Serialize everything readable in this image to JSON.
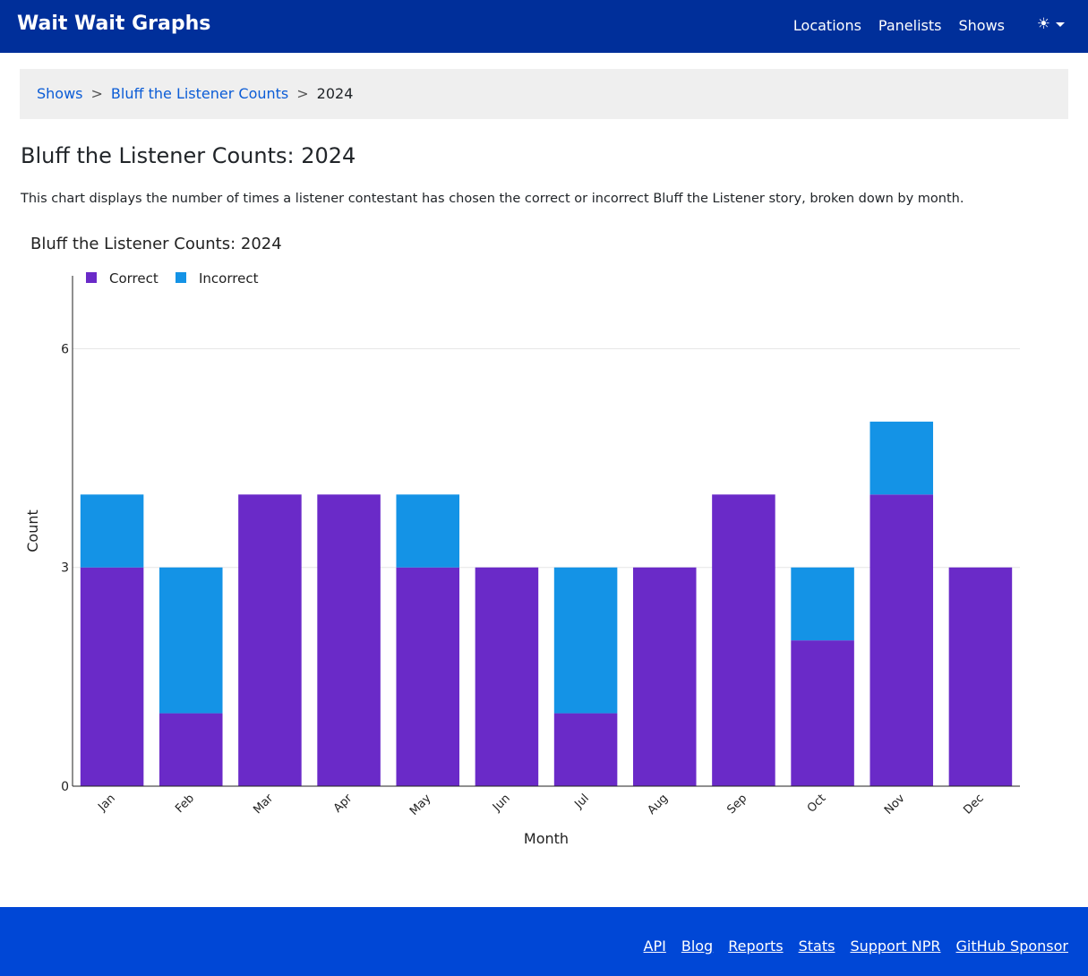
{
  "navbar": {
    "brand": "Wait Wait Graphs",
    "links": [
      "Locations",
      "Panelists",
      "Shows"
    ],
    "theme_icon": "sun-icon"
  },
  "breadcrumb": {
    "items": [
      "Shows",
      "Bluff the Listener Counts"
    ],
    "current": "2024",
    "separator": ">"
  },
  "page": {
    "title": "Bluff the Listener Counts: 2024",
    "description": "This chart displays the number of times a listener contestant has chosen the correct or incorrect Bluff the Listener story, broken down by month."
  },
  "chart_data": {
    "type": "bar",
    "stacked": true,
    "title": "Bluff the Listener Counts: 2024",
    "xlabel": "Month",
    "ylabel": "Count",
    "categories": [
      "Jan",
      "Feb",
      "Mar",
      "Apr",
      "May",
      "Jun",
      "Jul",
      "Aug",
      "Sep",
      "Oct",
      "Nov",
      "Dec"
    ],
    "series": [
      {
        "name": "Correct",
        "color": "#6a2ac8",
        "values": [
          3,
          1,
          4,
          4,
          3,
          3,
          1,
          3,
          4,
          2,
          4,
          3
        ]
      },
      {
        "name": "Incorrect",
        "color": "#1493e6",
        "values": [
          1,
          2,
          0,
          0,
          1,
          0,
          2,
          0,
          0,
          1,
          1,
          0
        ]
      }
    ],
    "ylim": [
      0,
      7
    ],
    "yticks": [
      0,
      3,
      6
    ],
    "grid": true,
    "legend": "top-left"
  },
  "footer": {
    "links": [
      "API",
      "Blog",
      "Reports",
      "Stats",
      "Support NPR",
      "GitHub Sponsor"
    ]
  }
}
